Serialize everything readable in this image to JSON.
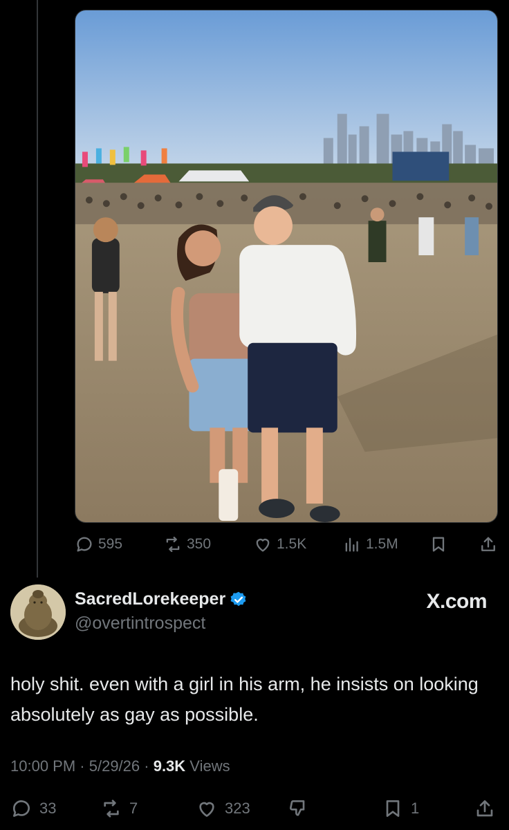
{
  "quoted_post": {
    "photo_alt": "",
    "metrics": {
      "replies": "595",
      "reposts": "350",
      "likes": "1.5K",
      "views": "1.5M"
    }
  },
  "author": {
    "display_name": "SacredLorekeeper",
    "handle": "@overtintrospect",
    "verified": true,
    "source": "X.com"
  },
  "post": {
    "text": "holy shit. even with a girl in his arm, he insists on looking absolutely as gay as possible.",
    "time": "10:00 PM",
    "sep1": " · ",
    "date": "5/29/26",
    "sep2": " · ",
    "views_count": "9.3K",
    "views_label": " Views"
  },
  "actions": {
    "replies": "33",
    "reposts": "7",
    "likes": "323",
    "bookmarks": "1"
  },
  "colors": {
    "background": "#000000",
    "text_primary": "#e7e9ea",
    "text_secondary": "#71767b",
    "verified_blue": "#1d9bf0"
  },
  "icons": [
    "reply-icon",
    "repost-icon",
    "like-icon",
    "views-icon",
    "bookmark-icon",
    "share-icon",
    "verified-badge-icon",
    "dislike-icon"
  ]
}
